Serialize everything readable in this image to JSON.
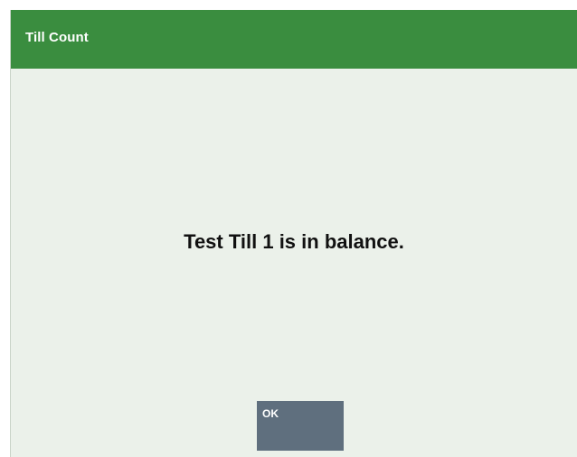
{
  "dialog": {
    "title": "Till Count",
    "message": "Test Till 1 is in balance.",
    "ok_label": "OK"
  },
  "colors": {
    "title_bar": "#3a8d3f",
    "dialog_background": "#ebf1ea",
    "button": "#5f6f7e",
    "title_text": "#ffffff",
    "message_text": "#111111"
  }
}
